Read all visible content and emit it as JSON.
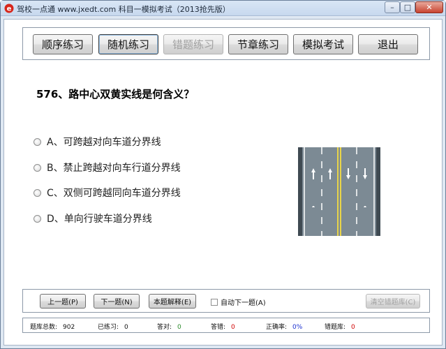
{
  "window": {
    "title": "驾校一点通 www.jxedt.com 科目一模拟考试（2013抢先版）"
  },
  "nav": {
    "items": [
      {
        "label": "顺序练习"
      },
      {
        "label": "随机练习"
      },
      {
        "label": "错题练习"
      },
      {
        "label": "节章练习"
      },
      {
        "label": "模拟考试"
      },
      {
        "label": "退出"
      }
    ]
  },
  "question": {
    "text": "576、路中心双黄实线是何含义？",
    "options": [
      {
        "label": "A、可跨越对向车道分界线"
      },
      {
        "label": "B、禁止跨越对向车行道分界线"
      },
      {
        "label": "C、双侧可跨越同向车道分界线"
      },
      {
        "label": "D、单向行驶车道分界线"
      }
    ]
  },
  "controls": {
    "prev_label": "上一题(P)",
    "next_label": "下一题(N)",
    "explain_label": "本题解释(E)",
    "auto_next_label": "自动下一题(A)",
    "clear_wrong_label": "清空错题库(C)"
  },
  "status": {
    "total_label": "题库总数:",
    "total": "902",
    "practiced_label": "已练习:",
    "practiced": "0",
    "correct_label": "答对:",
    "correct": "0",
    "wrong_label": "答错:",
    "wrong": "0",
    "rate_label": "正确率:",
    "rate": "0%",
    "wrongbank_label": "错题库:",
    "wrongbank": "0"
  },
  "colors": {
    "correct": "#2a8a2a",
    "wrong": "#d00000",
    "rate": "#1a2fcf",
    "center_line": "#e8d44a"
  }
}
